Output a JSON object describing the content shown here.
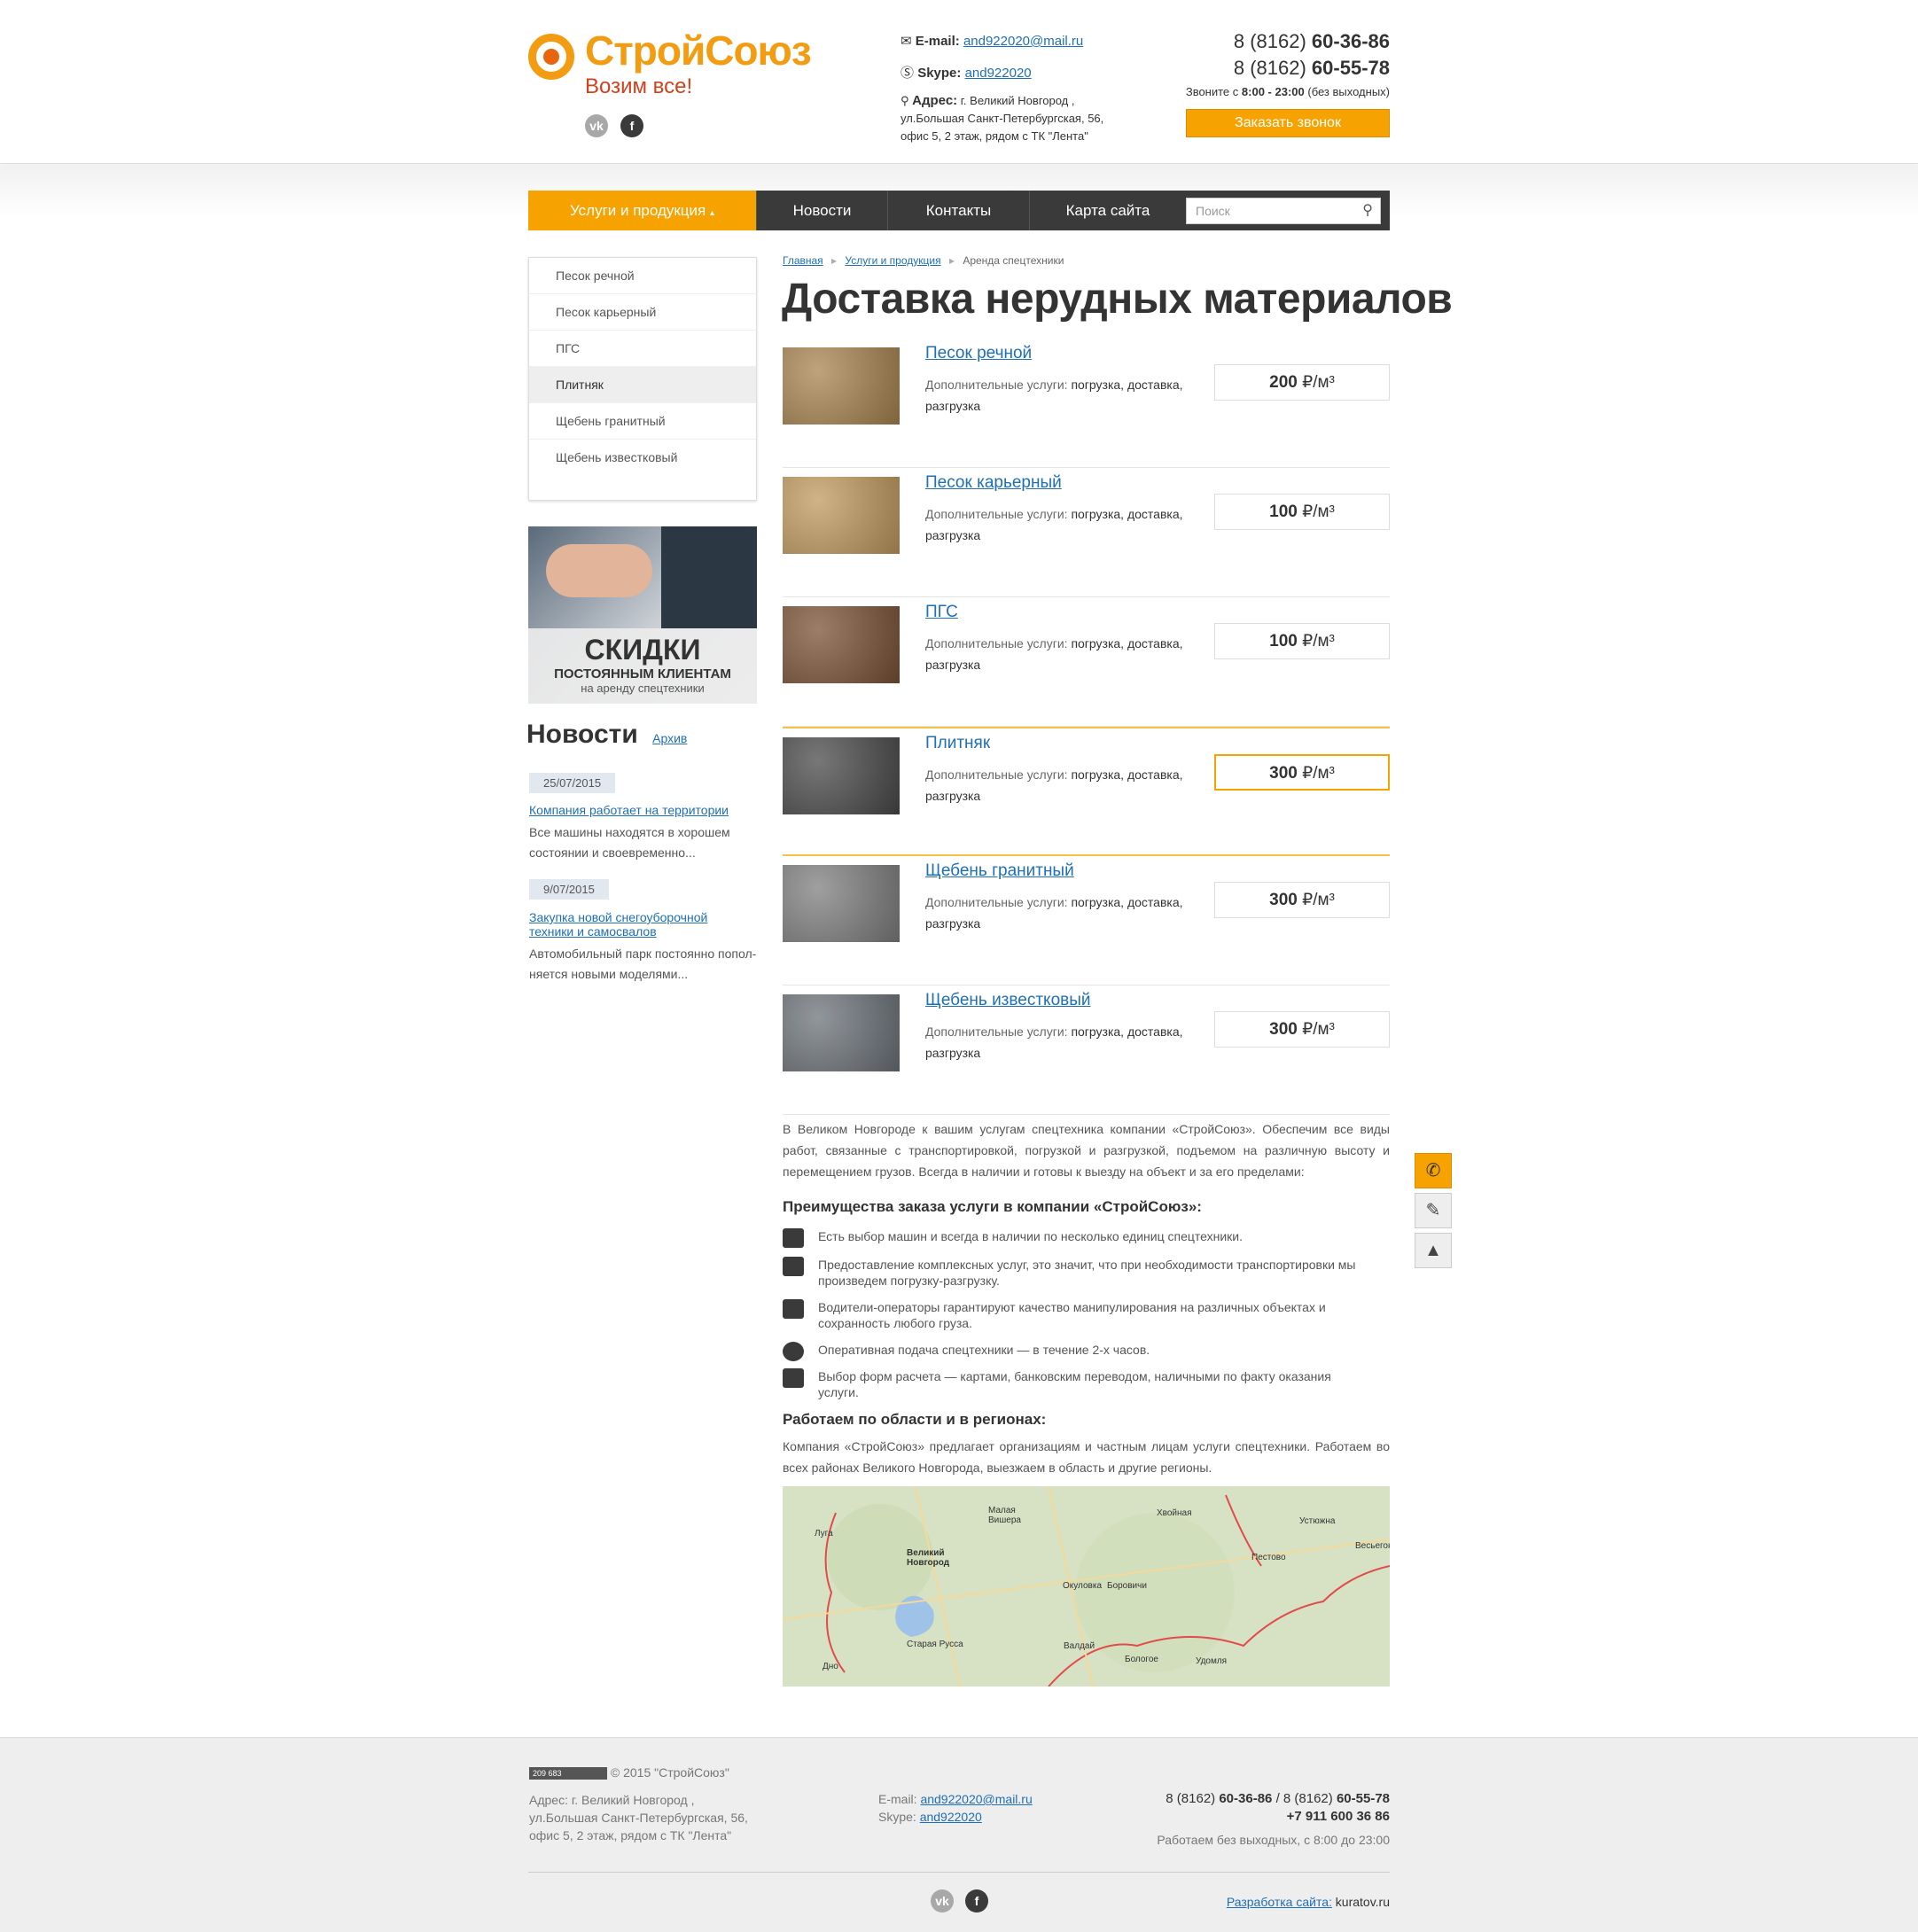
{
  "header": {
    "logo_name": "СтройСоюз",
    "logo_tag": "Возим все!",
    "email_label": "E-mail:",
    "email": "and922020@mail.ru",
    "skype_label": "Skype:",
    "skype": "and922020",
    "address_label": "Адрес:",
    "address_line1": "г. Великий Новгород ,",
    "address_line2": "ул.Большая Санкт-Петербургская, 56,",
    "address_line3": "офис 5, 2 этаж, рядом с ТК \"Лента\"",
    "phone1_code": "8 (8162)",
    "phone1_num": "60-36-86",
    "phone2_code": "8 (8162)",
    "phone2_num": "60-55-78",
    "call_note_pre": "Звоните с",
    "call_note_hours": "8:00 - 23:00",
    "call_note_post": "(без выходных)",
    "call_button": "Заказать звонок"
  },
  "nav": {
    "items": [
      "Услуги и продукция",
      "Новости",
      "Контакты",
      "Карта сайта"
    ],
    "search_placeholder": "Поиск"
  },
  "sidebar": {
    "items": [
      "Песок речной",
      "Песок карьерный",
      "ПГС",
      "Плитняк",
      "Щебень гранитный",
      "Щебень известковый"
    ],
    "banner_title": "СКИДКИ",
    "banner_sub": "ПОСТОЯННЫМ КЛИЕНТАМ",
    "banner_small": "на аренду спецтехники",
    "news_title": "Новости",
    "news_archive": "Архив",
    "news": [
      {
        "date": "25/07/2015",
        "title": "Компания работает на территории",
        "text": "Все машины находятся в хорошем состоянии и своевременно..."
      },
      {
        "date": "9/07/2015",
        "title": "Закупка новой снегоуборочной техники и самосвалов",
        "text": "Автомобильный парк постоянно попол-няется новыми моделями..."
      }
    ]
  },
  "main": {
    "breadcrumbs": [
      "Главная",
      "Услуги и продукция",
      "Аренда спецтехники"
    ],
    "title": "Доставка нерудных материалов",
    "desc_label": "Дополнительные услуги:",
    "desc_value": "погрузка, доставка, разгрузка",
    "unit": "₽/м³",
    "products": [
      {
        "name": "Песок речной",
        "price": "200",
        "color": "#a88450"
      },
      {
        "name": "Песок карьерный",
        "price": "100",
        "color": "#c19a5e"
      },
      {
        "name": "ПГС",
        "price": "100",
        "color": "#7a5236"
      },
      {
        "name": "Плитняк",
        "price": "300",
        "color": "#4a4a4a"
      },
      {
        "name": "Щебень гранитный",
        "price": "300",
        "color": "#7f7f7f"
      },
      {
        "name": "Щебень известковый",
        "price": "300",
        "color": "#6d737a"
      }
    ],
    "intro": "В Великом Новгороде к вашим услугам спецтехника компании «СтройСоюз». Обеспечим все виды работ, связанные с транспортировкой, погрузкой и разгрузкой, подъемом на различную высоту и перемещением грузов. Всегда в наличии и готовы к выезду на объект и за его пределами:",
    "adv_title": "Преимущества заказа услуги в компании «СтройСоюз»:",
    "advantages": [
      "Есть выбор машин и всегда в наличии по несколько единиц спецтехники.",
      "Предоставление комплексных услуг, это значит, что при необходимости транспортировки мы произведем погрузку-разгрузку.",
      "Водители-операторы гарантируют качество манипулирования на различных объектах и сохранность любого груза.",
      "Оперативная подача спецтехники — в течение 2-х часов.",
      "Выбор форм расчета — картами, банковским переводом, наличными по факту оказания услуги."
    ],
    "region_title": "Работаем по области и в регионах:",
    "region_text": "Компания «СтройСоюз» предлагает организациям и частным лицам услуги спецтехники. Работаем во всех районах Великого Новгорода, выезжаем в область и другие регионы.",
    "map_labels": [
      "Луга",
      "Малая Вишера",
      "Великий Новгород",
      "Хвойная",
      "Устюжна",
      "Весьегонск",
      "Пестово",
      "Окуловка",
      "Боровичи",
      "Старая Русса",
      "Валдай",
      "Бологое",
      "Удомля",
      "Дно"
    ]
  },
  "footer": {
    "counter": "209 683",
    "copyright": "© 2015 \"СтройСоюз\"",
    "address_line1": "Адрес: г. Великий Новгород ,",
    "address_line2": "ул.Большая Санкт-Петербургская, 56,",
    "address_line3": "офис 5, 2 этаж, рядом с ТК \"Лента\"",
    "email_label": "E-mail:",
    "email": "and922020@mail.ru",
    "skype_label": "Skype:",
    "skype": "and922020",
    "phones_line1_a": "8 (8162)",
    "phones_line1_b": "60-36-86",
    "phones_line1_sep": "/ 8 (8162)",
    "phones_line1_c": "60-55-78",
    "phones_line2": "+7 911 600 36 86",
    "hours": "Работаем без выходных, с 8:00 до 23:00",
    "dev_label": "Разработка сайта:",
    "dev_site": "kuratov.ru"
  },
  "colors": {
    "accent": "#f6a200",
    "link": "#1f6fb5",
    "nav_bg": "#3a3a3a"
  }
}
